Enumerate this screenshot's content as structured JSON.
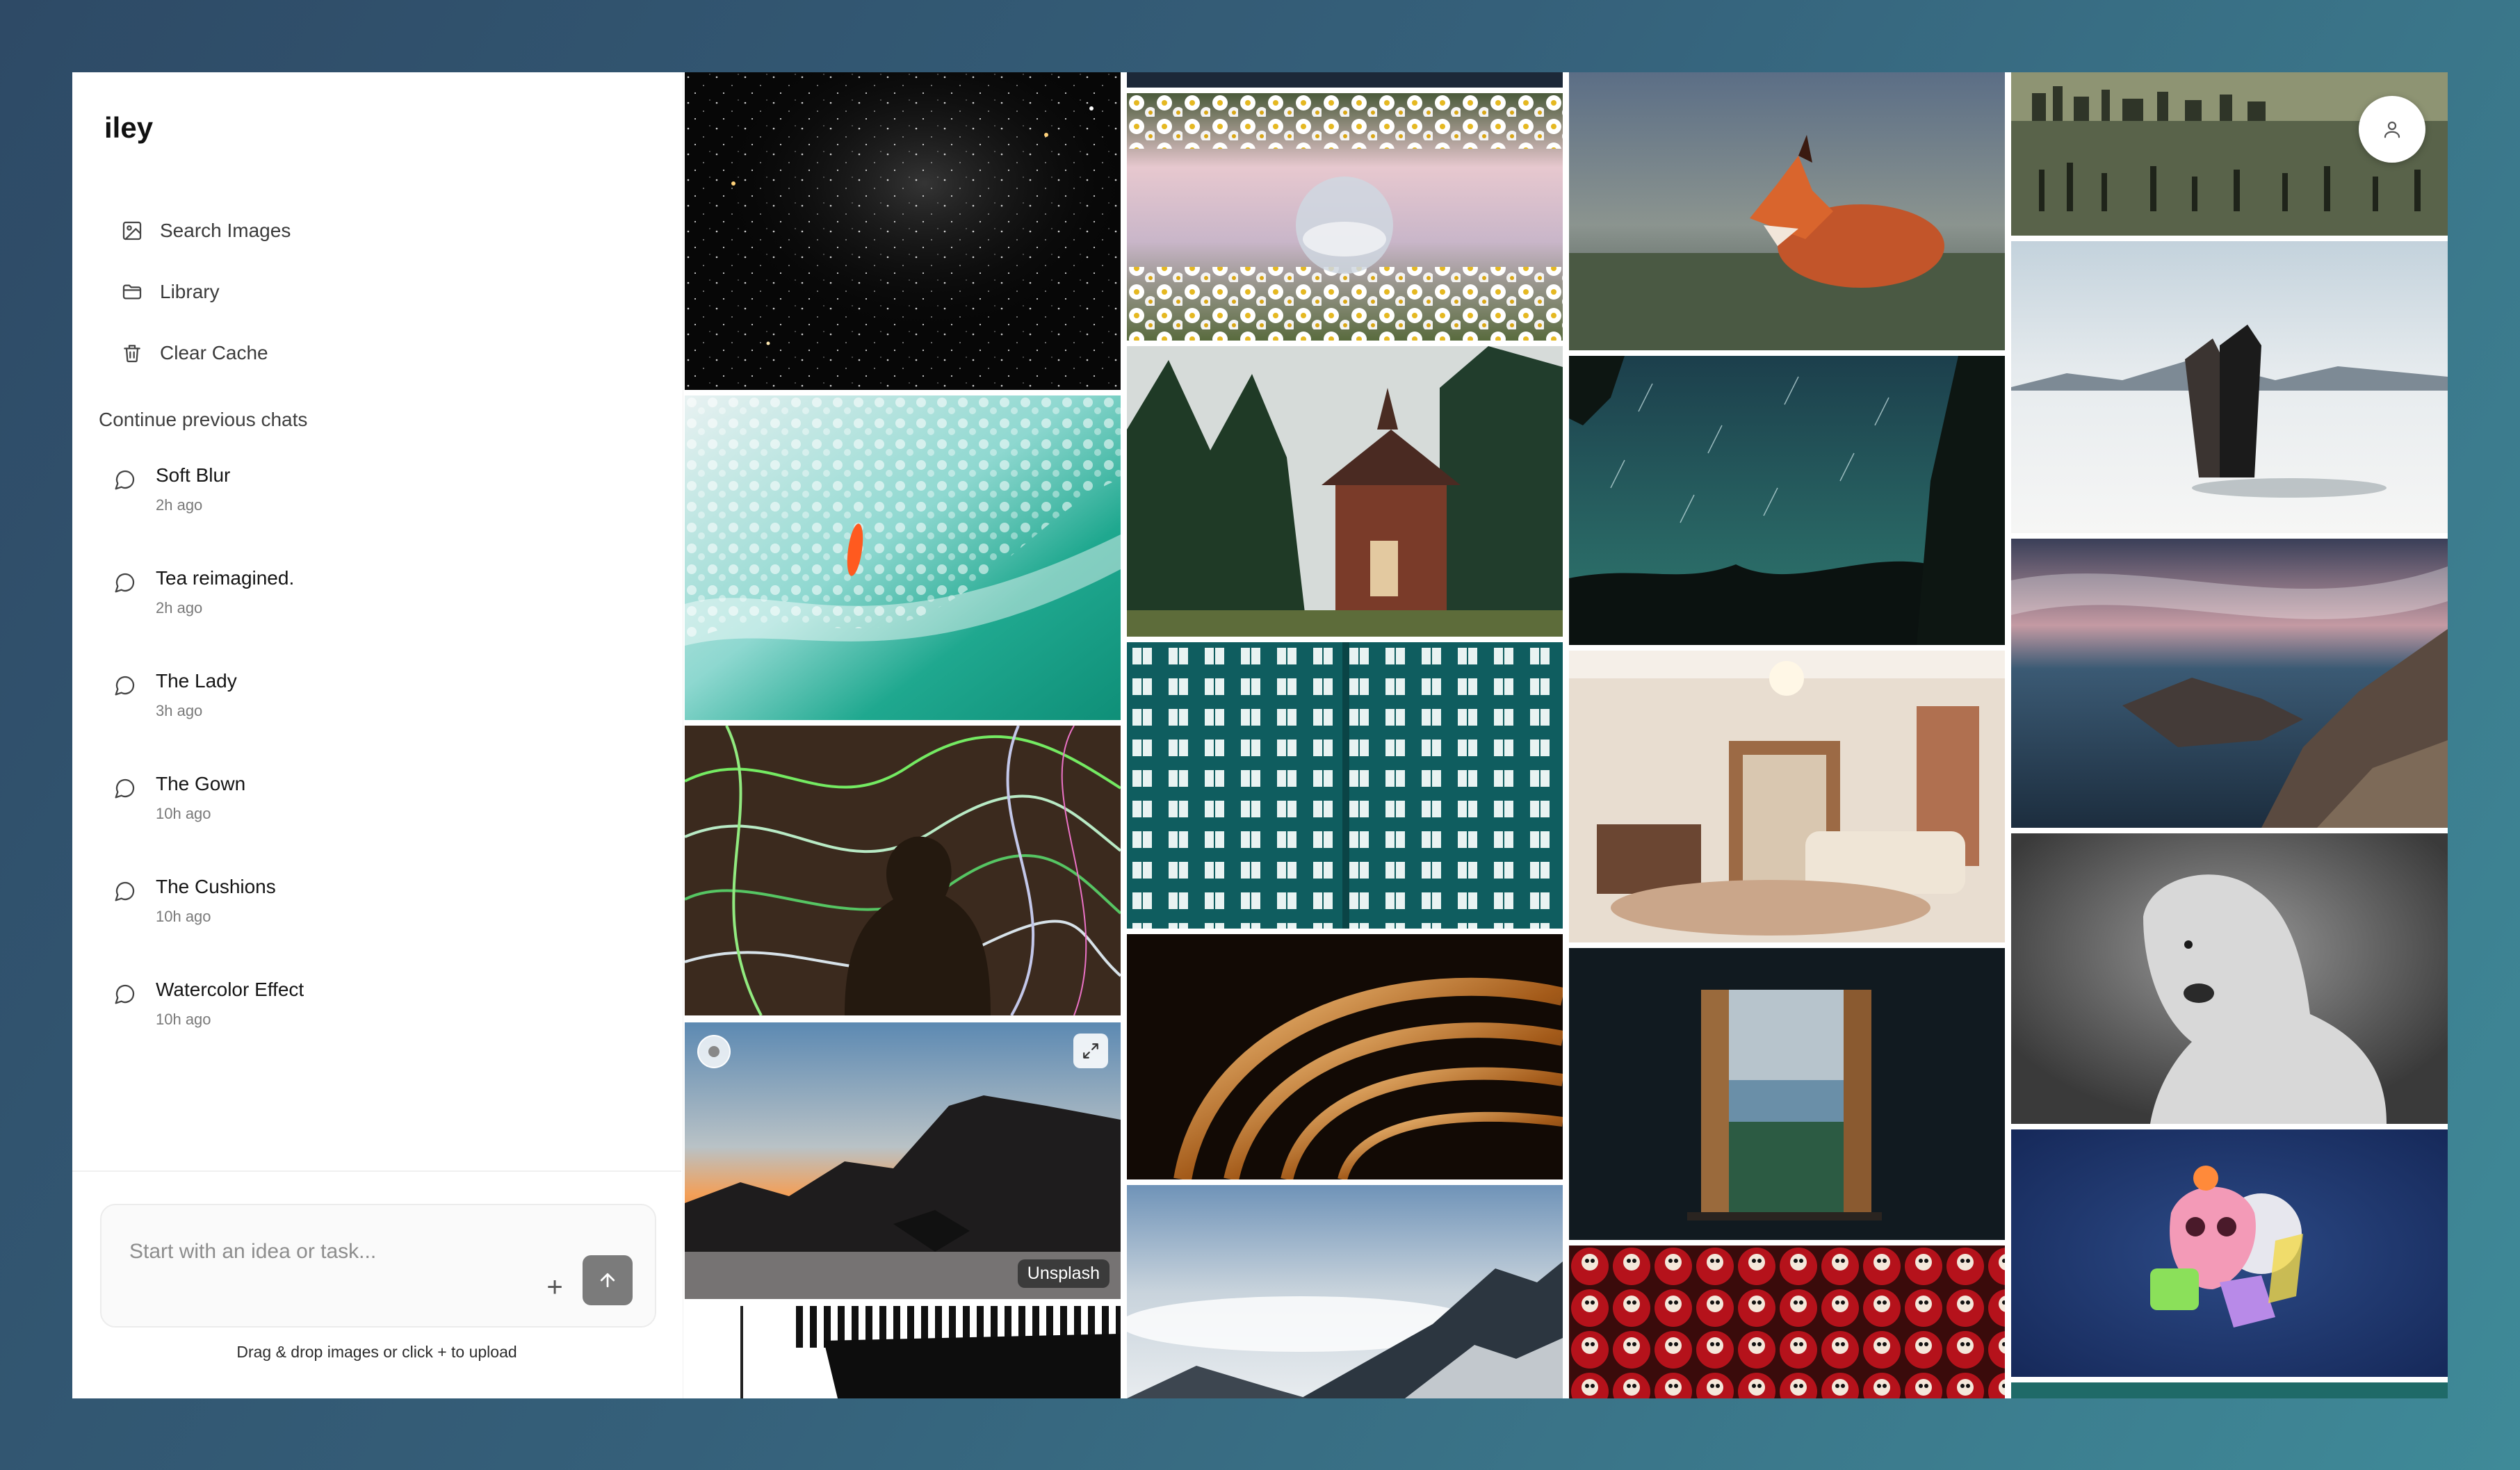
{
  "app": {
    "name": "iley"
  },
  "nav": [
    {
      "label": "Search Images",
      "icon": "image-search-icon"
    },
    {
      "label": "Library",
      "icon": "folder-icon"
    },
    {
      "label": "Clear Cache",
      "icon": "trash-icon"
    }
  ],
  "chats": {
    "heading": "Continue previous chats",
    "items": [
      {
        "title": "Soft Blur",
        "time": "2h ago"
      },
      {
        "title": "Tea reimagined.",
        "time": "2h ago"
      },
      {
        "title": "The Lady",
        "time": "3h ago"
      },
      {
        "title": "The Gown",
        "time": "10h ago"
      },
      {
        "title": "The Cushions",
        "time": "10h ago"
      },
      {
        "title": "Watercolor Effect",
        "time": "10h ago"
      }
    ]
  },
  "composer": {
    "placeholder": "Start with an idea or task...",
    "add_label": "+",
    "helper": "Drag & drop images or click + to upload"
  },
  "gallery": {
    "hovered_source": "Unsplash",
    "images": [
      {
        "subject": "starry night sky",
        "icon": "stars-image"
      },
      {
        "subject": "aerial ocean surfer",
        "icon": "ocean-image"
      },
      {
        "subject": "neon light silhouette",
        "icon": "neon-image"
      },
      {
        "subject": "coastal sunset cliffs",
        "icon": "sunset-image"
      },
      {
        "subject": "abstract black white lines",
        "icon": "lines-image"
      },
      {
        "subject": "daisies crystal ball",
        "icon": "daisies-image"
      },
      {
        "subject": "forest chapel",
        "icon": "chapel-image"
      },
      {
        "subject": "teal apartment facade",
        "icon": "building-image"
      },
      {
        "subject": "bronze abstract swirl",
        "icon": "swirl-image"
      },
      {
        "subject": "mountain above clouds",
        "icon": "mountain-image"
      },
      {
        "subject": "resting red fox",
        "icon": "fox-image"
      },
      {
        "subject": "star trails over trees",
        "icon": "startrails-image"
      },
      {
        "subject": "vintage living room",
        "icon": "room-image"
      },
      {
        "subject": "open window sea view",
        "icon": "window-image"
      },
      {
        "subject": "red daruma dolls",
        "icon": "daruma-image"
      },
      {
        "subject": "city skyline pier",
        "icon": "skyline-image"
      },
      {
        "subject": "couple on salt flats",
        "icon": "couple-image"
      },
      {
        "subject": "long exposure coast",
        "icon": "coast-image"
      },
      {
        "subject": "polar bear portrait",
        "icon": "polarbear-image"
      },
      {
        "subject": "3d colorful skull",
        "icon": "skull-image"
      }
    ]
  }
}
